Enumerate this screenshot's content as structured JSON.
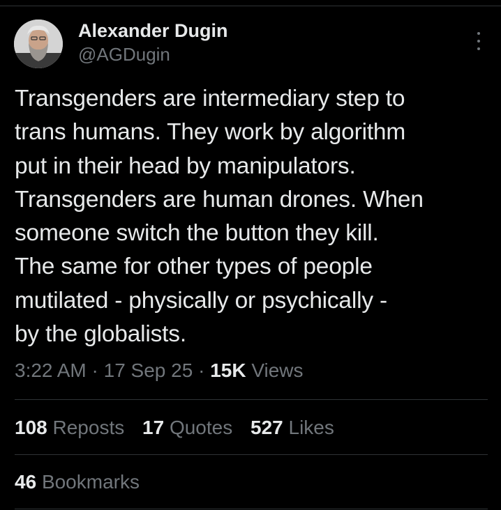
{
  "author": {
    "display_name": "Alexander Dugin",
    "handle": "@AGDugin"
  },
  "tweet": {
    "lines": [
      "Transgenders are intermediary step to",
      "trans humans. They work by algorithm",
      "put in their head by manipulators.",
      "Transgenders are human drones. When",
      "someone switch the button they kill.",
      "The same for other types of people",
      "mutilated - physically or psychically -",
      "by the globalists."
    ]
  },
  "meta": {
    "time": "3:22 AM",
    "separator": "·",
    "date": "17 Sep 25",
    "views_count": "15K",
    "views_label": "Views"
  },
  "stats": {
    "reposts_count": "108",
    "reposts_label": "Reposts",
    "quotes_count": "17",
    "quotes_label": "Quotes",
    "likes_count": "527",
    "likes_label": "Likes",
    "bookmarks_count": "46",
    "bookmarks_label": "Bookmarks"
  },
  "icons": {
    "more": "more-vertical-icon"
  },
  "colors": {
    "background": "#000000",
    "primary_text": "#e7e9ea",
    "secondary_text": "#71767b",
    "divider": "#2f3336"
  }
}
